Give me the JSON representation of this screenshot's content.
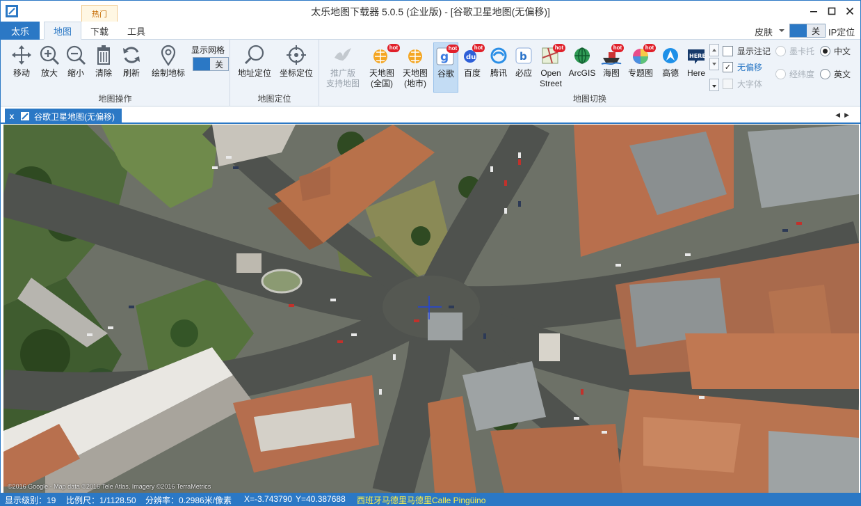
{
  "window": {
    "title": "太乐地图下载器 5.0.5 (企业版) - [谷歌卫星地图(无偏移)]",
    "minimize_glyph": "—",
    "maximize_glyph": "□",
    "close_glyph": "✕"
  },
  "tabs": {
    "app_menu": "太乐",
    "map": "地图",
    "download": "下载",
    "tools": "工具",
    "hot_badge": "热门",
    "active": "map"
  },
  "topright": {
    "skin": "皮肤",
    "skin_toggle_off": "关",
    "ip_locate": "IP定位"
  },
  "ribbon": {
    "map_ops": {
      "label": "地图操作",
      "buttons": [
        {
          "label": "移动",
          "icon": "move-icon"
        },
        {
          "label": "放大",
          "icon": "zoom-in-icon"
        },
        {
          "label": "缩小",
          "icon": "zoom-out-icon"
        },
        {
          "label": "清除",
          "icon": "trash-icon"
        },
        {
          "label": "刷新",
          "icon": "refresh-icon"
        },
        {
          "label": "绘制地标",
          "icon": "map-pin-icon"
        }
      ],
      "grid_label": "显示网格",
      "grid_toggle_off": "关"
    },
    "map_locate": {
      "label": "地图定位",
      "buttons": [
        {
          "label": "地址定位",
          "icon": "search-icon"
        },
        {
          "label": "坐标定位",
          "icon": "crosshair-icon"
        }
      ]
    },
    "map_switch": {
      "label": "地图切换",
      "hot_text": "hot",
      "sources": [
        {
          "label_1": "推广版",
          "label_2": "支持地图",
          "icon": "bird-icon",
          "disabled": true
        },
        {
          "label_1": "天地图",
          "label_2": "(全国)",
          "icon": "tianditu-icon",
          "hot": true
        },
        {
          "label_1": "天地图",
          "label_2": "(地市)",
          "icon": "tianditu-icon"
        },
        {
          "label_1": "谷歌",
          "label_2": "",
          "icon": "google-icon",
          "hot": true,
          "selected": true
        },
        {
          "label_1": "百度",
          "label_2": "",
          "icon": "baidu-icon",
          "hot": true
        },
        {
          "label_1": "腾讯",
          "label_2": "",
          "icon": "tencent-icon"
        },
        {
          "label_1": "必应",
          "label_2": "",
          "icon": "bing-icon"
        },
        {
          "label_1": "Open",
          "label_2": "Street",
          "icon": "openstreet-icon",
          "hot": true
        },
        {
          "label_1": "ArcGIS",
          "label_2": "",
          "icon": "arcgis-icon"
        },
        {
          "label_1": "海图",
          "label_2": "",
          "icon": "ship-icon",
          "hot": true
        },
        {
          "label_1": "专题图",
          "label_2": "",
          "icon": "color-wheel-icon",
          "hot": true
        },
        {
          "label_1": "高德",
          "label_2": "",
          "icon": "gaode-icon"
        },
        {
          "label_1": "Here",
          "label_2": "",
          "icon": "here-icon"
        }
      ],
      "options": {
        "show_annotation": "显示注记",
        "no_offset": "无偏移",
        "large_font": "大字体",
        "mercator": "墨卡托",
        "lonlat": "经纬度",
        "chinese": "中文",
        "english": "英文",
        "check_mark": "✓"
      }
    }
  },
  "doc_tab": {
    "close": "x",
    "title": "谷歌卫星地图(无偏移)",
    "prev": "◀",
    "next": "▶"
  },
  "map": {
    "copyright": "©2016 Google - Map data ©2016 Tele Atlas, Imagery ©2016 TerraMetrics"
  },
  "status": {
    "zoom_level": "显示级别：19",
    "scale": "比例尺：1/1128.50",
    "resolution": "分辨率：0.2986米/像素",
    "x": "X=-3.743790",
    "y": "Y=40.387688",
    "place": "西班牙马德里马德里Calle Pingüino"
  },
  "colors": {
    "accent": "#2b78c5",
    "ribbon_bg": "#eef3f9",
    "status_place": "#fff14a",
    "hot_red": "#e0202a"
  }
}
